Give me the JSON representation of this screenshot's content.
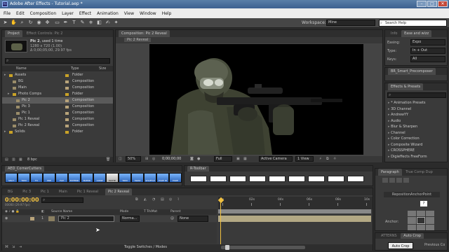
{
  "window": {
    "title": "Adobe After Effects - Tutorial.aep *",
    "app_icon": "Ae"
  },
  "menu": [
    "File",
    "Edit",
    "Composition",
    "Layer",
    "Effect",
    "Animation",
    "View",
    "Window",
    "Help"
  ],
  "toolbar": {
    "workspace_label": "Workspace:",
    "workspace_value": "Mine",
    "search_placeholder": "Search Help"
  },
  "project": {
    "tab": "Project",
    "tab2": "Effect Controls: Pic 2",
    "selected_name": "Pic 2",
    "used": ", used 1 time",
    "dims": "1280 x 720 (1.00)",
    "duration": "Δ 0;00;05;00, 29.97 fps",
    "search_placeholder": "",
    "col_name": "Name",
    "col_type": "Type",
    "col_size": "Size",
    "items": [
      {
        "name": "Assets",
        "type": "Folder",
        "kind": "folder",
        "indent": 0
      },
      {
        "name": "BG",
        "type": "Composition",
        "kind": "comp",
        "indent": 1
      },
      {
        "name": "Main",
        "type": "Composition",
        "kind": "comp",
        "indent": 1
      },
      {
        "name": "Photo Comps",
        "type": "Folder",
        "kind": "folder",
        "indent": 1
      },
      {
        "name": "Pic 2",
        "type": "Composition",
        "kind": "comp",
        "indent": 2,
        "selected": true
      },
      {
        "name": "Pic 3",
        "type": "Composition",
        "kind": "comp",
        "indent": 2
      },
      {
        "name": "Pic 1",
        "type": "Composition",
        "kind": "comp",
        "indent": 2
      },
      {
        "name": "Pic 1 Reveal",
        "type": "Composition",
        "kind": "comp",
        "indent": 1
      },
      {
        "name": "Pic 2 Reveal",
        "type": "Composition",
        "kind": "comp",
        "indent": 1
      },
      {
        "name": "Solids",
        "type": "Folder",
        "kind": "folder",
        "indent": 0
      }
    ],
    "bpc": "8 bpc"
  },
  "comp_viewer": {
    "tab": "Composition: Pic 2 Reveal",
    "subtab": "Pic 2 Reveal",
    "zoom": "50%",
    "timecode": "0;00;00;00",
    "resolution": "Full",
    "camera": "Active Camera",
    "views": "1 View"
  },
  "info": {
    "tab1": "Info",
    "tab2": "Ease and wizz",
    "easing_label": "Easing:",
    "easing": "Expo",
    "type_label": "Type:",
    "type": "In + Out",
    "keys_label": "Keys:",
    "keys": "All",
    "apply": "Apply"
  },
  "br_panel": {
    "tab": "BR_Smart_Precomposer"
  },
  "effects": {
    "tab": "Effects & Presets",
    "search_placeholder": "",
    "items": [
      "* Animation Presets",
      "3D Channel",
      "AndrewYY",
      "Audio",
      "Blur & Sharpen",
      "Channel",
      "Color Correction",
      "Composite Wizard",
      "CROSSPHERE",
      "Digieffects FreeForm"
    ]
  },
  "aed": {
    "tab": "AED_CornerCutters",
    "buttons": [
      "SPLIT",
      "TRIM",
      "FX",
      "PRE",
      "FLIP",
      "EXTEND",
      "BLEND",
      "COMP",
      "MATTE",
      "TRIM",
      "SWAP",
      "SHUFFLE",
      "FADE IN",
      "FADE"
    ]
  },
  "rtoolbar": {
    "tab": "R-Toolbar"
  },
  "paragraph": {
    "tab1": "Paragraph",
    "tab2": "True Comp Dup"
  },
  "reposition": {
    "title": "RepositionAnchorPoint",
    "value": "?",
    "anchor_label": "Anchor:"
  },
  "timeline": {
    "tabs": [
      "BG",
      "Pic 3",
      "Pic 1",
      "Main",
      "Pic 1 Reveal",
      "Pic 2 Reveal"
    ],
    "timecode": "0:00:00:00",
    "frame": "00000 (29.97 fps)",
    "col_source": "Source Name",
    "col_mode": "Mode",
    "col_trk": "T TrkMat",
    "col_parent": "Parent",
    "ruler": [
      "0s",
      "02s",
      "04s",
      "06s",
      "08s",
      "10s"
    ],
    "layer": {
      "num": "1",
      "name": "Pic 2",
      "mode": "Norma...",
      "parent": "None"
    },
    "toggle": "Toggle Switches / Modes"
  },
  "bottom_right": {
    "tab1": "ATTERNS",
    "tab2": "Auto Crop",
    "button": "Auto Crop",
    "preview": "Previous Co"
  }
}
